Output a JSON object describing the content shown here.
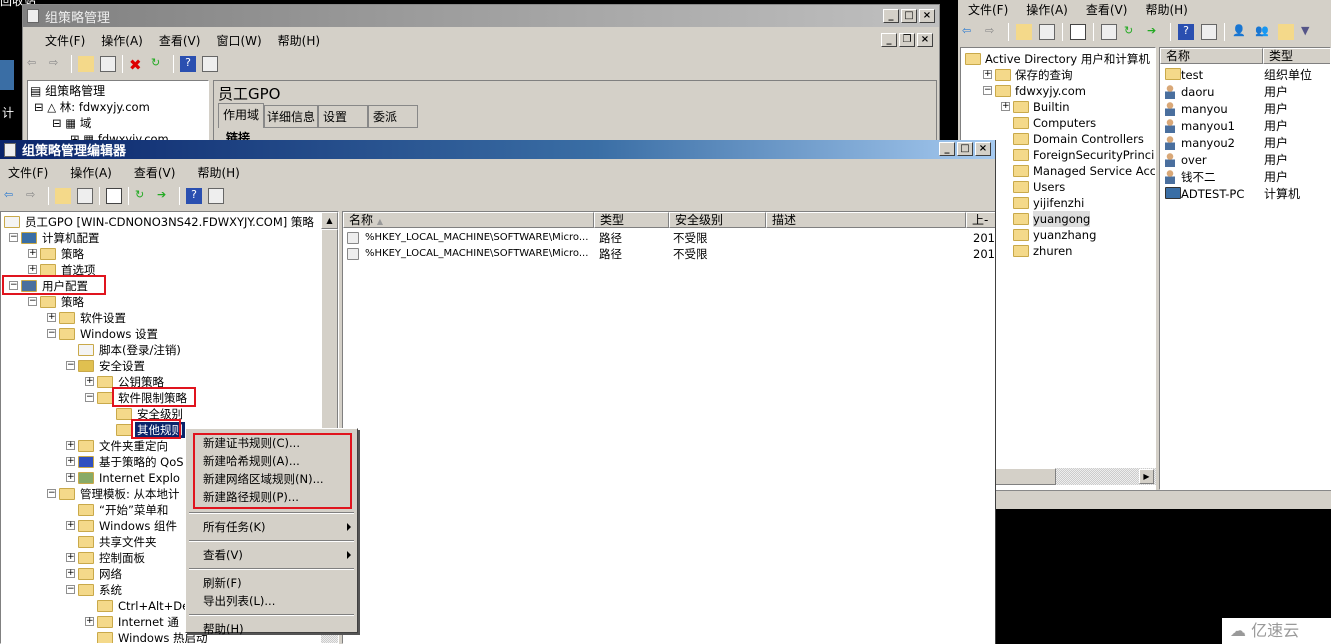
{
  "desktop": {
    "label_top": "回收站",
    "label_left": "计"
  },
  "gpmc": {
    "title": "组策略管理",
    "menu": [
      "文件(F)",
      "操作(A)",
      "查看(V)",
      "窗口(W)",
      "帮助(H)"
    ],
    "tree": [
      "组策略管理",
      "林: fdwxyjy.com",
      "域",
      "fdwxyjy.com"
    ],
    "gpo_title": "员工GPO",
    "tabs": [
      "作用域",
      "详细信息",
      "设置",
      "委派"
    ],
    "section": "链接"
  },
  "ad": {
    "menu": [
      "文件(F)",
      "操作(A)",
      "查看(V)",
      "帮助(H)"
    ],
    "tree": [
      {
        "t": "Active Directory 用户和计算机",
        "lvl": 0,
        "e": ""
      },
      {
        "t": "保存的查询",
        "lvl": 1,
        "e": "+"
      },
      {
        "t": "fdwxyjy.com",
        "lvl": 1,
        "e": "-"
      },
      {
        "t": "Builtin",
        "lvl": 2,
        "e": "+"
      },
      {
        "t": "Computers",
        "lvl": 2,
        "e": ""
      },
      {
        "t": "Domain Controllers",
        "lvl": 2,
        "e": ""
      },
      {
        "t": "ForeignSecurityPrincip",
        "lvl": 2,
        "e": ""
      },
      {
        "t": "Managed Service Accour",
        "lvl": 2,
        "e": ""
      },
      {
        "t": "Users",
        "lvl": 2,
        "e": ""
      },
      {
        "t": "yijifenzhi",
        "lvl": 2,
        "e": ""
      },
      {
        "t": "yuangong",
        "lvl": 2,
        "e": "",
        "sel": true
      },
      {
        "t": "yuanzhang",
        "lvl": 2,
        "e": ""
      },
      {
        "t": "zhuren",
        "lvl": 2,
        "e": ""
      }
    ],
    "columns": [
      "名称",
      "类型"
    ],
    "items": [
      {
        "name": "test",
        "type": "组织单位",
        "icon": "ou"
      },
      {
        "name": "daoru",
        "type": "用户",
        "icon": "user"
      },
      {
        "name": "manyou",
        "type": "用户",
        "icon": "user"
      },
      {
        "name": "manyou1",
        "type": "用户",
        "icon": "user"
      },
      {
        "name": "manyou2",
        "type": "用户",
        "icon": "user"
      },
      {
        "name": "over",
        "type": "用户",
        "icon": "user"
      },
      {
        "name": "钱不二",
        "type": "用户",
        "icon": "user"
      },
      {
        "name": "ADTEST-PC",
        "type": "计算机",
        "icon": "computer"
      }
    ]
  },
  "editor": {
    "title": "组策略管理编辑器",
    "menu": [
      "文件(F)",
      "操作(A)",
      "查看(V)",
      "帮助(H)"
    ],
    "tree": [
      {
        "t": "员工GPO [WIN-CDNONO3NS42.FDWXYJY.COM] 策略",
        "lvl": 0,
        "e": "",
        "i": "doc"
      },
      {
        "t": "计算机配置",
        "lvl": 1,
        "e": "-",
        "i": "pc"
      },
      {
        "t": "策略",
        "lvl": 2,
        "e": "+",
        "i": "f"
      },
      {
        "t": "首选项",
        "lvl": 2,
        "e": "+",
        "i": "f"
      },
      {
        "t": "用户配置",
        "lvl": 1,
        "e": "-",
        "i": "user",
        "box": true
      },
      {
        "t": "策略",
        "lvl": 2,
        "e": "-",
        "i": "f"
      },
      {
        "t": "软件设置",
        "lvl": 3,
        "e": "+",
        "i": "f"
      },
      {
        "t": "Windows 设置",
        "lvl": 3,
        "e": "-",
        "i": "f"
      },
      {
        "t": "脚本(登录/注销)",
        "lvl": 4,
        "e": "",
        "i": "doc"
      },
      {
        "t": "安全设置",
        "lvl": 4,
        "e": "-",
        "i": "lock"
      },
      {
        "t": "公钥策略",
        "lvl": 5,
        "e": "+",
        "i": "f"
      },
      {
        "t": "软件限制策略",
        "lvl": 5,
        "e": "-",
        "i": "f",
        "box": true
      },
      {
        "t": "安全级别",
        "lvl": 6,
        "e": "",
        "i": "f"
      },
      {
        "t": "其他规则",
        "lvl": 6,
        "e": "",
        "i": "f",
        "box": true,
        "sel": true
      },
      {
        "t": "文件夹重定向",
        "lvl": 4,
        "e": "+",
        "i": "f"
      },
      {
        "t": "基于策略的 QoS",
        "lvl": 4,
        "e": "+",
        "i": "chart"
      },
      {
        "t": "Internet Explo",
        "lvl": 4,
        "e": "+",
        "i": "ie"
      },
      {
        "t": "管理模板: 从本地计",
        "lvl": 3,
        "e": "-",
        "i": "f"
      },
      {
        "t": "“开始”菜单和",
        "lvl": 4,
        "e": "",
        "i": "f"
      },
      {
        "t": "Windows 组件",
        "lvl": 4,
        "e": "+",
        "i": "f"
      },
      {
        "t": "共享文件夹",
        "lvl": 4,
        "e": "",
        "i": "f"
      },
      {
        "t": "控制面板",
        "lvl": 4,
        "e": "+",
        "i": "f"
      },
      {
        "t": "网络",
        "lvl": 4,
        "e": "+",
        "i": "f"
      },
      {
        "t": "系统",
        "lvl": 4,
        "e": "-",
        "i": "f"
      },
      {
        "t": "Ctrl+Alt+De",
        "lvl": 5,
        "e": "",
        "i": "f"
      },
      {
        "t": "Internet 通",
        "lvl": 5,
        "e": "+",
        "i": "f"
      },
      {
        "t": "Windows 热启动",
        "lvl": 5,
        "e": "",
        "i": "f"
      }
    ],
    "columns": [
      "名称",
      "类型",
      "安全级别",
      "描述",
      "上-"
    ],
    "rows": [
      {
        "name": "%HKEY_LOCAL_MACHINE\\SOFTWARE\\Micro...",
        "type": "路径",
        "level": "不受限",
        "desc": "",
        "date": "201"
      },
      {
        "name": "%HKEY_LOCAL_MACHINE\\SOFTWARE\\Micro...",
        "type": "路径",
        "level": "不受限",
        "desc": "",
        "date": "201"
      }
    ]
  },
  "context_menu": {
    "groups": [
      [
        "新建证书规则(C)...",
        "新建哈希规则(A)...",
        "新建网络区域规则(N)...",
        "新建路径规则(P)..."
      ],
      [
        "所有任务(K)"
      ],
      [
        "查看(V)"
      ],
      [
        "刷新(F)",
        "导出列表(L)..."
      ],
      [
        "帮助(H)"
      ]
    ]
  },
  "watermark": "亿速云"
}
